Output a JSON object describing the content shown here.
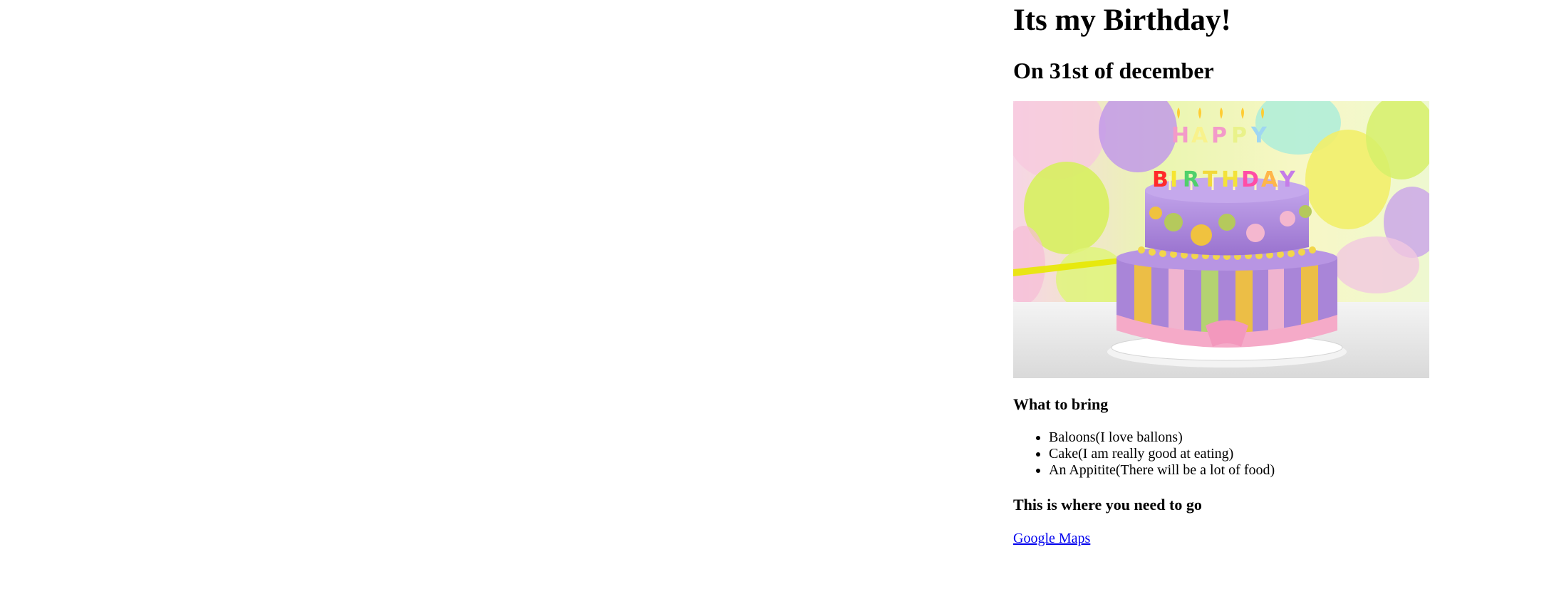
{
  "page": {
    "title": "Its my Birthday!",
    "subtitle": "On 31st of december",
    "image": {
      "name": "birthday-cake-photo",
      "colors": {
        "sky": "#f7f1c8",
        "balloon_purple": "#b98fe6",
        "balloon_green": "#d5f05a",
        "balloon_yellow": "#f3ee6f",
        "balloon_pink": "#f6c4dc",
        "cake_purple": "#a985d8",
        "cake_pink": "#f4b7cf",
        "table": "#e9e9e9"
      }
    },
    "bring": {
      "heading": "What to bring",
      "items": [
        "Baloons(I love ballons)",
        "Cake(I am really good at eating)",
        "An Appitite(There will be a lot of food)"
      ]
    },
    "directions": {
      "heading": "This is where you need to go",
      "link_text": "Google Maps"
    }
  }
}
